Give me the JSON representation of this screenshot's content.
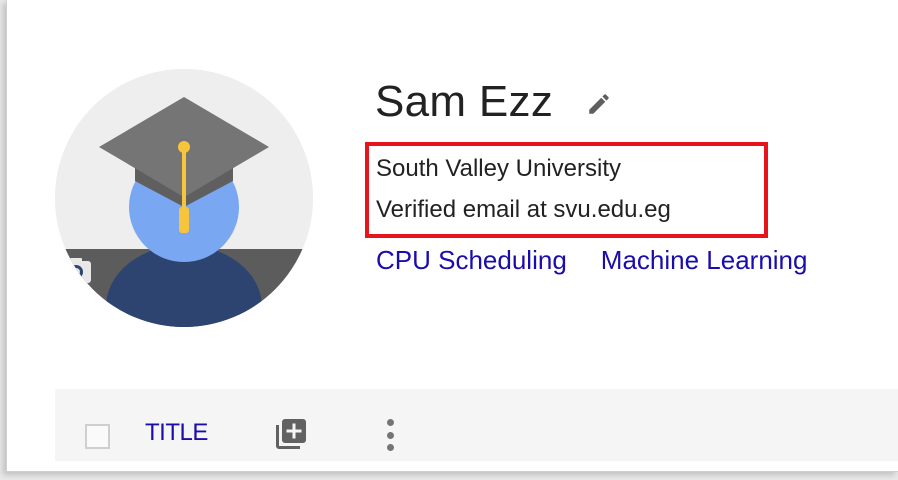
{
  "profile": {
    "name": "Sam Ezz",
    "affiliation": "South Valley University",
    "email": "Verified email at svu.edu.eg",
    "interests": [
      "CPU Scheduling",
      "Machine Learning"
    ]
  },
  "toolbar": {
    "title_label": "TITLE"
  },
  "icons": {
    "avatar": "graduation-cap-avatar",
    "photo": "add-photo-icon",
    "edit": "pencil-icon",
    "add": "add-box-icon",
    "more": "more-vertical-icon"
  },
  "colors": {
    "link": "#1a0dab",
    "highlight": "#e8141b",
    "text": "#222222"
  }
}
